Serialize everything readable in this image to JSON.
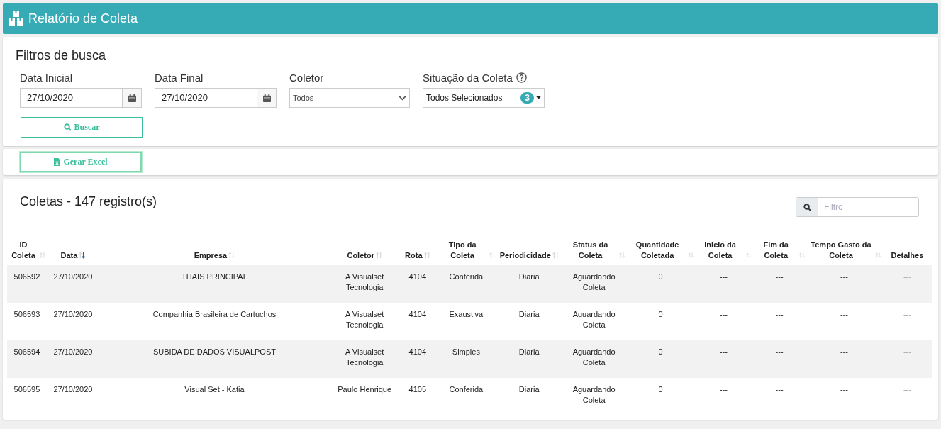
{
  "header": {
    "title": "Relatório de Coleta"
  },
  "filters": {
    "title": "Filtros de busca",
    "date_start": {
      "label": "Data Inicial",
      "value": "27/10/2020"
    },
    "date_end": {
      "label": "Data Final",
      "value": "27/10/2020"
    },
    "collector": {
      "label": "Coletor",
      "value": "Todos"
    },
    "status": {
      "label": "Situação da Coleta",
      "value": "Todos Selecionados",
      "count": "3"
    },
    "search_button": "Buscar"
  },
  "export_button": "Gerar Excel",
  "table": {
    "title": "Coletas - 147 registro(s)",
    "filter_placeholder": "Filtro",
    "columns": [
      {
        "label": "ID Coleta",
        "sortable": true,
        "sorted": false
      },
      {
        "label": "Data",
        "sortable": true,
        "sorted": true
      },
      {
        "label": "Empresa",
        "sortable": true,
        "sorted": false
      },
      {
        "label": "Coletor",
        "sortable": true,
        "sorted": false
      },
      {
        "label": "Rota",
        "sortable": true,
        "sorted": false
      },
      {
        "label": "Tipo da Coleta",
        "sortable": true,
        "sorted": false
      },
      {
        "label": "Periodicidade",
        "sortable": true,
        "sorted": false
      },
      {
        "label": "Status da Coleta",
        "sortable": true,
        "sorted": false
      },
      {
        "label": "Quantidade Coletada",
        "sortable": true,
        "sorted": false
      },
      {
        "label": "Inicio da Coleta",
        "sortable": true,
        "sorted": false
      },
      {
        "label": "Fim da Coleta",
        "sortable": true,
        "sorted": false
      },
      {
        "label": "Tempo Gasto da Coleta",
        "sortable": true,
        "sorted": false
      },
      {
        "label": "Detalhes",
        "sortable": false,
        "muted": true
      }
    ],
    "rows": [
      [
        "506592",
        "27/10/2020",
        "THAIS PRINCIPAL",
        "A Visualset Tecnologia",
        "4104",
        "Conferida",
        "Diaria",
        "Aguardando Coleta",
        "0",
        "---",
        "---",
        "---",
        "---"
      ],
      [
        "506593",
        "27/10/2020",
        "Companhia Brasileira de Cartuchos",
        "A Visualset Tecnologia",
        "4104",
        "Exaustiva",
        "Diaria",
        "Aguardando Coleta",
        "0",
        "---",
        "---",
        "---",
        "---"
      ],
      [
        "506594",
        "27/10/2020",
        "SUBIDA DE DADOS VISUALPOST",
        "A Visualset Tecnologia",
        "4104",
        "Simples",
        "Diaria",
        "Aguardando Coleta",
        "0",
        "---",
        "---",
        "---",
        "---"
      ],
      [
        "506595",
        "27/10/2020",
        "Visual Set - Katia",
        "Paulo Henrique",
        "4105",
        "Conferida",
        "Diaria",
        "Aguardando Coleta",
        "0",
        "---",
        "---",
        "---",
        "---"
      ]
    ]
  }
}
